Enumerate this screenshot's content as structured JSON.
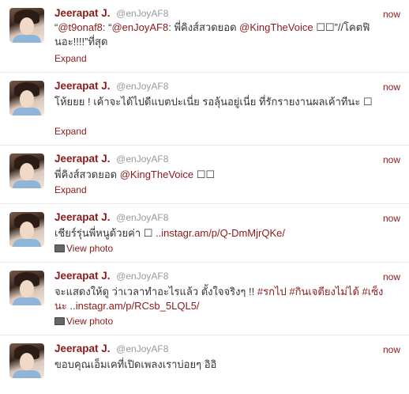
{
  "tweets": [
    {
      "name": "Jeerapat J.",
      "handle": "@enJoyAF8",
      "time": "now",
      "text_parts": [
        {
          "t": "“",
          "link": false
        },
        {
          "t": "@t9onaf8",
          "link": true
        },
        {
          "t": ": “",
          "link": false
        },
        {
          "t": "@enJoyAF8",
          "link": true
        },
        {
          "t": ": พี่คิงส์สวดยอด ",
          "link": false
        },
        {
          "t": "@KingTheVoice",
          "link": true
        },
        {
          "t": " ☐☐”//โคตฟินอะ!!!!”ที่สุด",
          "link": false
        }
      ],
      "action": "Expand"
    },
    {
      "name": "Jeerapat J.",
      "handle": "@enJoyAF8",
      "time": "now",
      "text_parts": [
        {
          "t": "โห้ยยย ! เค้าจะได้ไปดีแบตปะเนี่ย รอลุ้นอยู่เนี่ย ที่รักรายงานผลเค้าทีนะ ☐",
          "link": false
        }
      ],
      "action": "Expand"
    },
    {
      "name": "Jeerapat J.",
      "handle": "@enJoyAF8",
      "time": "now",
      "text_parts": [
        {
          "t": "พี่คิงส์สวดยอด ",
          "link": false
        },
        {
          "t": "@KingTheVoice",
          "link": true
        },
        {
          "t": " ☐☐",
          "link": false
        }
      ],
      "action": "Expand"
    },
    {
      "name": "Jeerapat J.",
      "handle": "@enJoyAF8",
      "time": "now",
      "text_parts": [
        {
          "t": "เชียร์รุ่นพี่หนูด้วยค่า ☐ ",
          "link": false
        },
        {
          "t": "..instagr.am/p/Q-DmMjrQKe/",
          "link": true
        }
      ],
      "action": "View photo"
    },
    {
      "name": "Jeerapat J.",
      "handle": "@enJoyAF8",
      "time": "now",
      "text_parts": [
        {
          "t": "จะแสดงให้ดู ว่าเวลาทำอะไรแล้ว ตั้งใจจริงๆ !! ",
          "link": false
        },
        {
          "t": "#รกไป",
          "link": true
        },
        {
          "t": " ",
          "link": false
        },
        {
          "t": "#กินเจตียงไม่ได้",
          "link": true
        },
        {
          "t": " ",
          "link": false
        },
        {
          "t": "#เซ็งนะ",
          "link": true
        },
        {
          "t": " ",
          "link": false
        },
        {
          "t": "..instagr.am/p/RCsb_5LQL5/",
          "link": true
        }
      ],
      "action": "View photo"
    },
    {
      "name": "Jeerapat J.",
      "handle": "@enJoyAF8",
      "time": "now",
      "text_parts": [
        {
          "t": "ขอบคุณเอ็มเคที่เปิดเพลงเราบ่อยๆ อิอิ",
          "link": false
        }
      ],
      "action": ""
    }
  ],
  "colors": {
    "name": "#8b1a1a",
    "link": "#8b1a1a",
    "handle": "#999999",
    "divider": "#e8e8e8"
  },
  "icons": {
    "view_photo": "photo-icon"
  }
}
